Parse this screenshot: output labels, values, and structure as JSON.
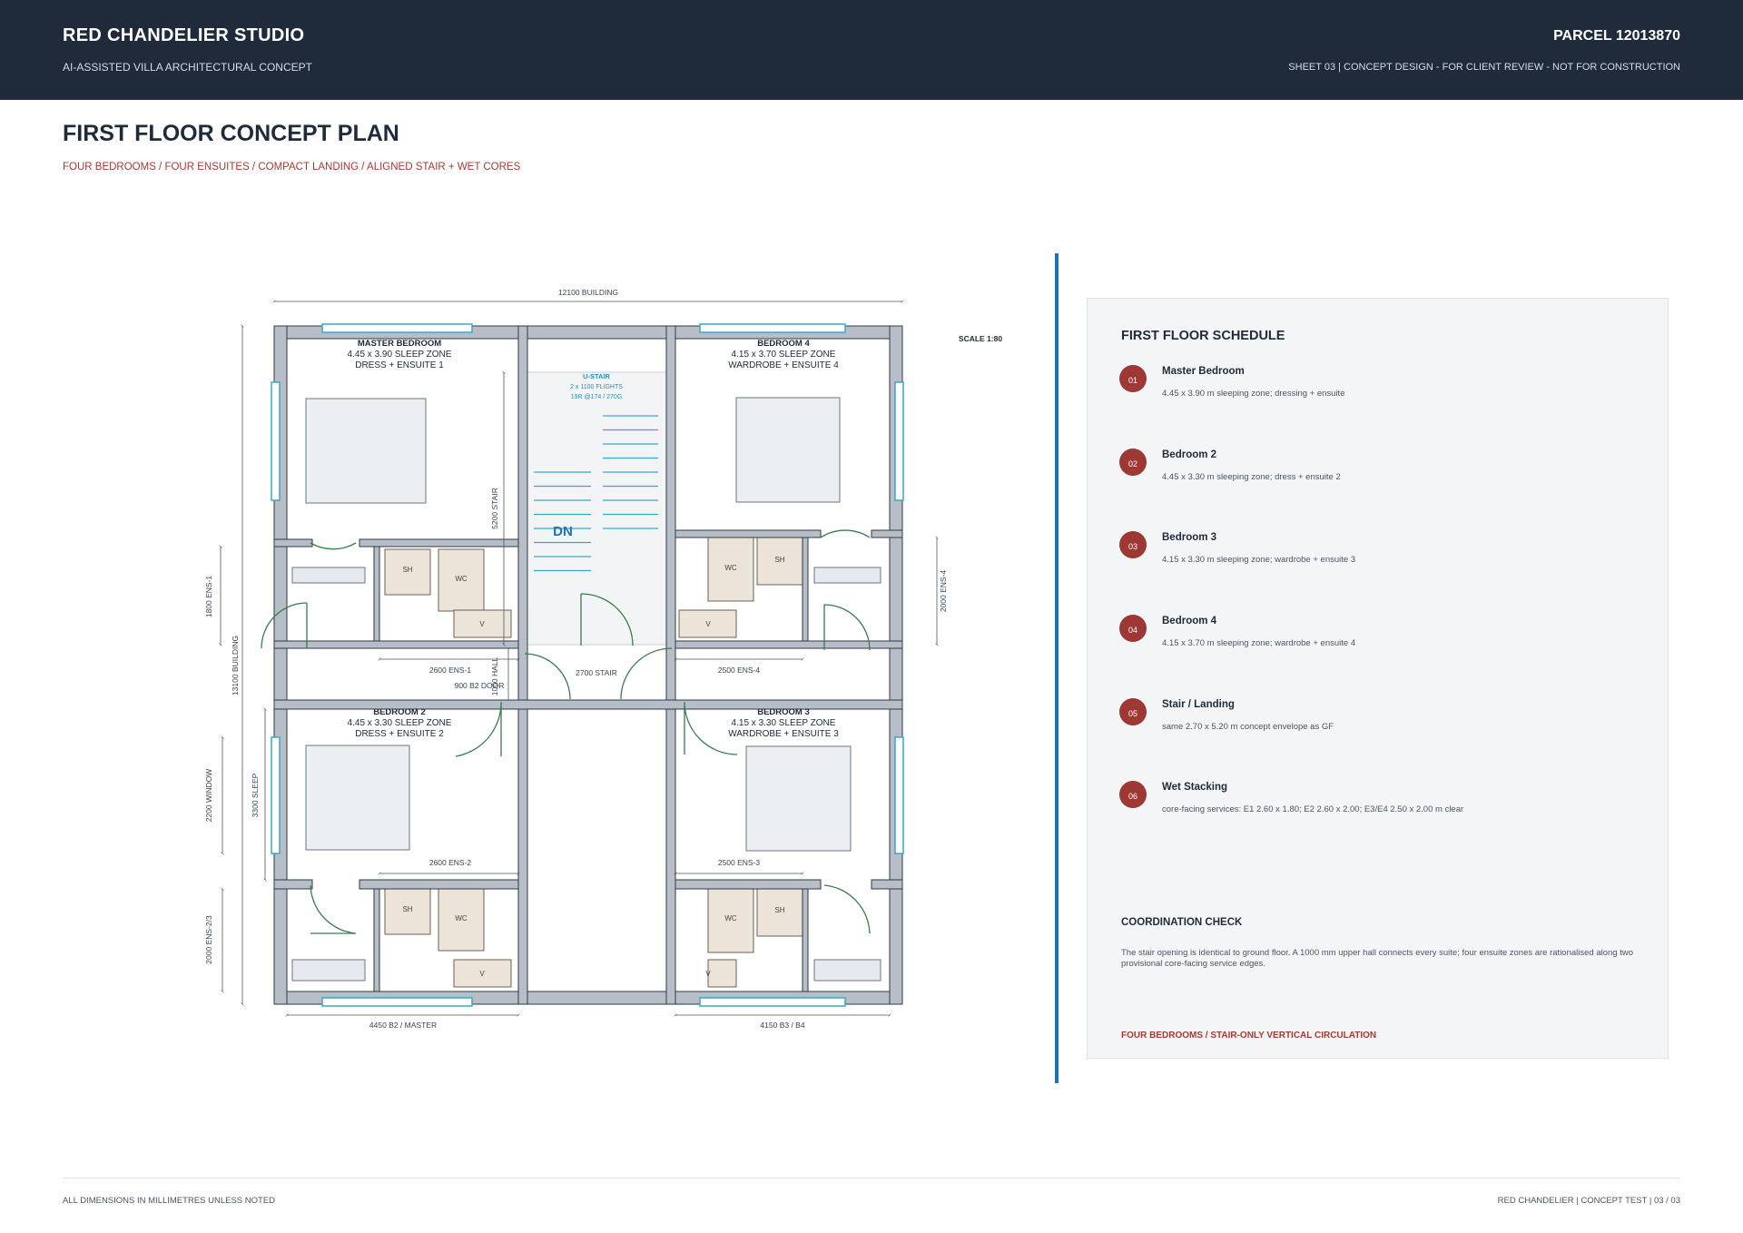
{
  "header": {
    "studio": "RED CHANDELIER STUDIO",
    "concept": "AI-ASSISTED VILLA ARCHITECTURAL CONCEPT",
    "parcel": "PARCEL 12013870",
    "sheet": "SHEET 03  |  CONCEPT DESIGN - FOR CLIENT REVIEW - NOT FOR CONSTRUCTION"
  },
  "title": "FIRST FLOOR CONCEPT PLAN",
  "subtitle": "FOUR BEDROOMS / FOUR ENSUITES / COMPACT LANDING / ALIGNED STAIR + WET CORES",
  "plan": {
    "scale": "SCALE 1:80",
    "rooms": {
      "master": [
        "MASTER BEDROOM",
        "4.45 x 3.90 SLEEP ZONE",
        "DRESS + ENSUITE 1"
      ],
      "bed4": [
        "BEDROOM 4",
        "4.15 x 3.70 SLEEP ZONE",
        "WARDROBE + ENSUITE 4"
      ],
      "bed2": [
        "BEDROOM 2",
        "4.45 x 3.30 SLEEP ZONE",
        "DRESS + ENSUITE 2"
      ],
      "bed3": [
        "BEDROOM 3",
        "4.15 x 3.30 SLEEP ZONE",
        "WARDROBE + ENSUITE 3"
      ]
    },
    "stair": [
      "U-STAIR",
      "2 x 1100 FLIGHTS",
      "19R @174 / 270G"
    ],
    "dn": "DN",
    "fixtures": {
      "sh": "SH",
      "wc": "WC",
      "v": "V"
    },
    "dims": {
      "building_w": "12100 BUILDING",
      "building_h": "13100 BUILDING",
      "stair_len": "5200 STAIR",
      "ens1_h": "1800 ENS-1",
      "ens4_h": "2000 ENS-4",
      "window": "2200 WINDOW",
      "sleep": "3300 SLEEP",
      "ens23_h": "2000 ENS-2/3",
      "ens1_w": "2600 ENS-1",
      "stair_w": "2700 STAIR",
      "ens4_w": "2500 ENS-4",
      "b2door": "900 B2 DOOR",
      "hall": "1000 HALL",
      "ens2_w": "2600 ENS-2",
      "ens3_w": "2500 ENS-3",
      "bottom_left": "4450 B2 / MASTER",
      "bottom_right": "4150 B3 / B4"
    }
  },
  "schedule": {
    "title": "FIRST FLOOR SCHEDULE",
    "items": [
      {
        "num": "01",
        "name": "Master Bedroom",
        "desc": "4.45 x 3.90 m sleeping zone; dressing + ensuite"
      },
      {
        "num": "02",
        "name": "Bedroom 2",
        "desc": "4.45 x 3.30 m sleeping zone; dress + ensuite 2"
      },
      {
        "num": "03",
        "name": "Bedroom 3",
        "desc": "4.15 x 3.30 m sleeping zone; wardrobe + ensuite 3"
      },
      {
        "num": "04",
        "name": "Bedroom 4",
        "desc": "4.15 x 3.70 m sleeping zone; wardrobe + ensuite 4"
      },
      {
        "num": "05",
        "name": "Stair / Landing",
        "desc": "same 2.70 x 5.20 m concept envelope as GF"
      },
      {
        "num": "06",
        "name": "Wet Stacking",
        "desc": "core-facing services: E1 2.60 x 1.80; E2 2.60 x 2.00; E3/E4 2.50 x 2.00 m clear"
      }
    ],
    "coord_title": "COORDINATION CHECK",
    "coord_body": "The stair opening is identical to ground floor. A 1000 mm upper hall connects every suite; four ensuite zones are rationalised along two provisional core-facing service edges.",
    "coord_foot": "FOUR BEDROOMS / STAIR-ONLY VERTICAL CIRCULATION"
  },
  "footer": {
    "left": "ALL DIMENSIONS IN MILLIMETRES UNLESS NOTED",
    "right": "RED CHANDELIER | CONCEPT TEST | 03 / 03"
  },
  "colors": {
    "header_bg": "#1f2b3a",
    "accent_red": "#a23c33",
    "accent_blue": "#1d72b8",
    "wall": "#b7bec7",
    "fixture": "#ece4d8",
    "door": "#3d7a4f",
    "window": "#3aa7c9"
  }
}
